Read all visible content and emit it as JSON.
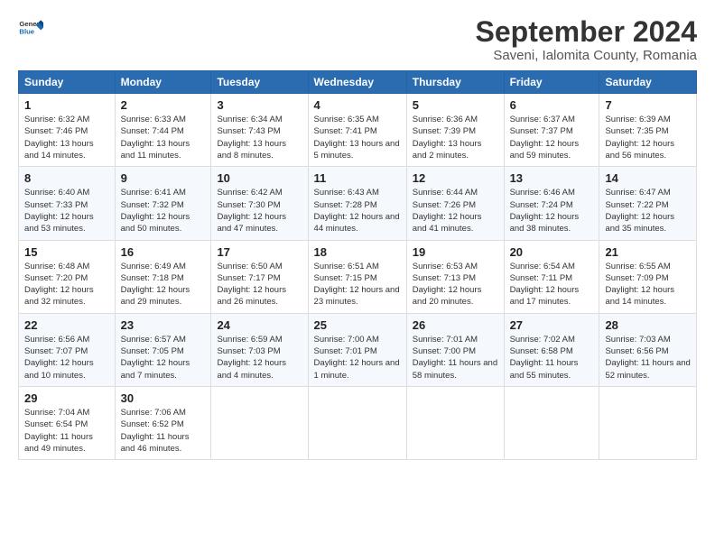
{
  "header": {
    "logo_line1": "General",
    "logo_line2": "Blue",
    "month_title": "September 2024",
    "subtitle": "Saveni, Ialomita County, Romania"
  },
  "days_of_week": [
    "Sunday",
    "Monday",
    "Tuesday",
    "Wednesday",
    "Thursday",
    "Friday",
    "Saturday"
  ],
  "weeks": [
    [
      {
        "day": "1",
        "info": "Sunrise: 6:32 AM\nSunset: 7:46 PM\nDaylight: 13 hours and 14 minutes."
      },
      {
        "day": "2",
        "info": "Sunrise: 6:33 AM\nSunset: 7:44 PM\nDaylight: 13 hours and 11 minutes."
      },
      {
        "day": "3",
        "info": "Sunrise: 6:34 AM\nSunset: 7:43 PM\nDaylight: 13 hours and 8 minutes."
      },
      {
        "day": "4",
        "info": "Sunrise: 6:35 AM\nSunset: 7:41 PM\nDaylight: 13 hours and 5 minutes."
      },
      {
        "day": "5",
        "info": "Sunrise: 6:36 AM\nSunset: 7:39 PM\nDaylight: 13 hours and 2 minutes."
      },
      {
        "day": "6",
        "info": "Sunrise: 6:37 AM\nSunset: 7:37 PM\nDaylight: 12 hours and 59 minutes."
      },
      {
        "day": "7",
        "info": "Sunrise: 6:39 AM\nSunset: 7:35 PM\nDaylight: 12 hours and 56 minutes."
      }
    ],
    [
      {
        "day": "8",
        "info": "Sunrise: 6:40 AM\nSunset: 7:33 PM\nDaylight: 12 hours and 53 minutes."
      },
      {
        "day": "9",
        "info": "Sunrise: 6:41 AM\nSunset: 7:32 PM\nDaylight: 12 hours and 50 minutes."
      },
      {
        "day": "10",
        "info": "Sunrise: 6:42 AM\nSunset: 7:30 PM\nDaylight: 12 hours and 47 minutes."
      },
      {
        "day": "11",
        "info": "Sunrise: 6:43 AM\nSunset: 7:28 PM\nDaylight: 12 hours and 44 minutes."
      },
      {
        "day": "12",
        "info": "Sunrise: 6:44 AM\nSunset: 7:26 PM\nDaylight: 12 hours and 41 minutes."
      },
      {
        "day": "13",
        "info": "Sunrise: 6:46 AM\nSunset: 7:24 PM\nDaylight: 12 hours and 38 minutes."
      },
      {
        "day": "14",
        "info": "Sunrise: 6:47 AM\nSunset: 7:22 PM\nDaylight: 12 hours and 35 minutes."
      }
    ],
    [
      {
        "day": "15",
        "info": "Sunrise: 6:48 AM\nSunset: 7:20 PM\nDaylight: 12 hours and 32 minutes."
      },
      {
        "day": "16",
        "info": "Sunrise: 6:49 AM\nSunset: 7:18 PM\nDaylight: 12 hours and 29 minutes."
      },
      {
        "day": "17",
        "info": "Sunrise: 6:50 AM\nSunset: 7:17 PM\nDaylight: 12 hours and 26 minutes."
      },
      {
        "day": "18",
        "info": "Sunrise: 6:51 AM\nSunset: 7:15 PM\nDaylight: 12 hours and 23 minutes."
      },
      {
        "day": "19",
        "info": "Sunrise: 6:53 AM\nSunset: 7:13 PM\nDaylight: 12 hours and 20 minutes."
      },
      {
        "day": "20",
        "info": "Sunrise: 6:54 AM\nSunset: 7:11 PM\nDaylight: 12 hours and 17 minutes."
      },
      {
        "day": "21",
        "info": "Sunrise: 6:55 AM\nSunset: 7:09 PM\nDaylight: 12 hours and 14 minutes."
      }
    ],
    [
      {
        "day": "22",
        "info": "Sunrise: 6:56 AM\nSunset: 7:07 PM\nDaylight: 12 hours and 10 minutes."
      },
      {
        "day": "23",
        "info": "Sunrise: 6:57 AM\nSunset: 7:05 PM\nDaylight: 12 hours and 7 minutes."
      },
      {
        "day": "24",
        "info": "Sunrise: 6:59 AM\nSunset: 7:03 PM\nDaylight: 12 hours and 4 minutes."
      },
      {
        "day": "25",
        "info": "Sunrise: 7:00 AM\nSunset: 7:01 PM\nDaylight: 12 hours and 1 minute."
      },
      {
        "day": "26",
        "info": "Sunrise: 7:01 AM\nSunset: 7:00 PM\nDaylight: 11 hours and 58 minutes."
      },
      {
        "day": "27",
        "info": "Sunrise: 7:02 AM\nSunset: 6:58 PM\nDaylight: 11 hours and 55 minutes."
      },
      {
        "day": "28",
        "info": "Sunrise: 7:03 AM\nSunset: 6:56 PM\nDaylight: 11 hours and 52 minutes."
      }
    ],
    [
      {
        "day": "29",
        "info": "Sunrise: 7:04 AM\nSunset: 6:54 PM\nDaylight: 11 hours and 49 minutes."
      },
      {
        "day": "30",
        "info": "Sunrise: 7:06 AM\nSunset: 6:52 PM\nDaylight: 11 hours and 46 minutes."
      },
      {
        "day": "",
        "info": ""
      },
      {
        "day": "",
        "info": ""
      },
      {
        "day": "",
        "info": ""
      },
      {
        "day": "",
        "info": ""
      },
      {
        "day": "",
        "info": ""
      }
    ]
  ]
}
